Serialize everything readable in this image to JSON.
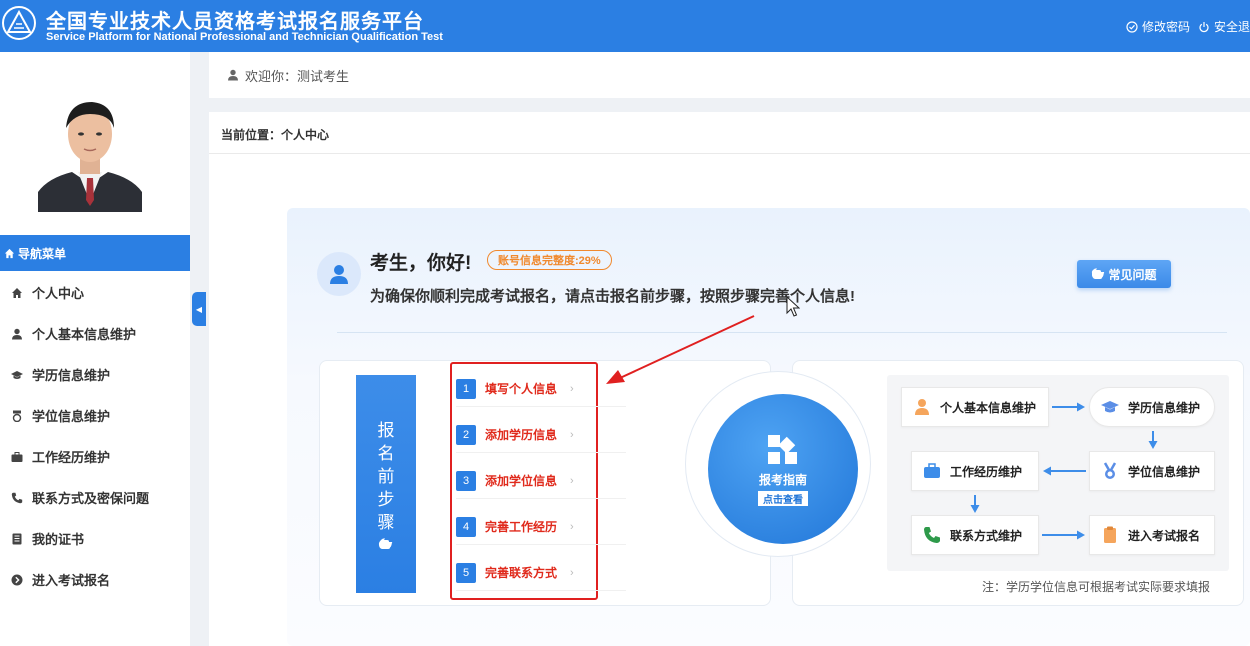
{
  "header": {
    "title_cn": "全国专业技术人员资格考试报名服务平台",
    "title_en": "Service Platform for National Professional and Technician Qualification Test",
    "change_password": "修改密码",
    "logout": "安全退"
  },
  "sidebar": {
    "menu_title": "导航菜单",
    "items": [
      {
        "label": "个人中心",
        "icon": "home-icon"
      },
      {
        "label": "个人基本信息维护",
        "icon": "user-icon"
      },
      {
        "label": "学历信息维护",
        "icon": "graduation-cap-icon"
      },
      {
        "label": "学位信息维护",
        "icon": "medal-icon"
      },
      {
        "label": "工作经历维护",
        "icon": "briefcase-icon"
      },
      {
        "label": "联系方式及密保问题",
        "icon": "phone-icon"
      },
      {
        "label": "我的证书",
        "icon": "book-icon"
      },
      {
        "label": "进入考试报名",
        "icon": "arrow-circle-icon"
      }
    ]
  },
  "welcome": {
    "text": "欢迎你：测试考生"
  },
  "breadcrumb": {
    "text": "当前位置：个人中心"
  },
  "greeting": {
    "title": "考生，你好!",
    "badge": "账号信息完整度:29%",
    "subtitle": "为确保你顺利完成考试报名，请点击报名前步骤，按照步骤完善个人信息!",
    "faq_button": "常见问题"
  },
  "steps": {
    "banner": [
      "报",
      "名",
      "前",
      "步",
      "骤"
    ],
    "items": [
      {
        "num": "1",
        "label": "填写个人信息"
      },
      {
        "num": "2",
        "label": "添加学历信息"
      },
      {
        "num": "3",
        "label": "添加学位信息"
      },
      {
        "num": "4",
        "label": "完善工作经历"
      },
      {
        "num": "5",
        "label": "完善联系方式"
      }
    ],
    "arrow": "›"
  },
  "guide": {
    "title": "报考指南",
    "subtitle": "点击查看"
  },
  "flow": {
    "nodes": {
      "basic": "个人基本信息维护",
      "education": "学历信息维护",
      "work": "工作经历维护",
      "degree": "学位信息维护",
      "contact": "联系方式维护",
      "enroll": "进入考试报名"
    },
    "note": "注：学历学位信息可根据考试实际要求填报"
  },
  "colors": {
    "primary": "#2b7fe3",
    "alert": "#e02020",
    "badge": "#f0892e"
  }
}
